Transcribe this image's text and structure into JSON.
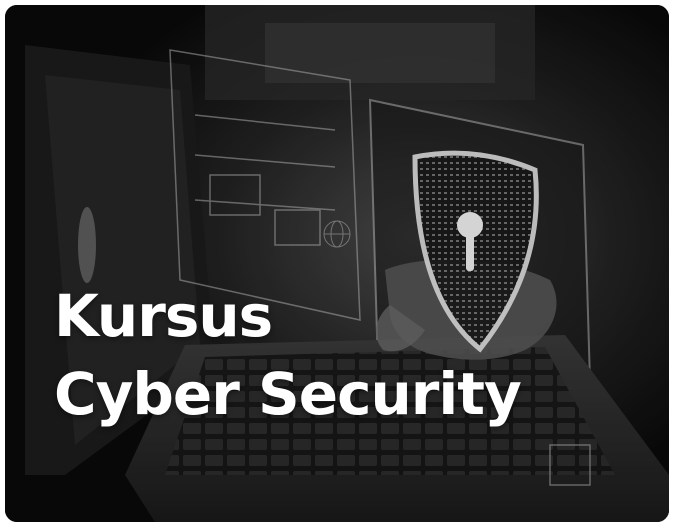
{
  "card": {
    "title_line1": "Kursus",
    "title_line2": "Cyber Security"
  },
  "visual": {
    "background_subject": "hand typing on laptop keyboard with holographic security shield and padlock",
    "icons": [
      "shield-lock-icon",
      "globe-icon"
    ],
    "colors": {
      "background": "#0c0c0c",
      "text": "#ffffff",
      "frame": "#ffffff"
    }
  }
}
